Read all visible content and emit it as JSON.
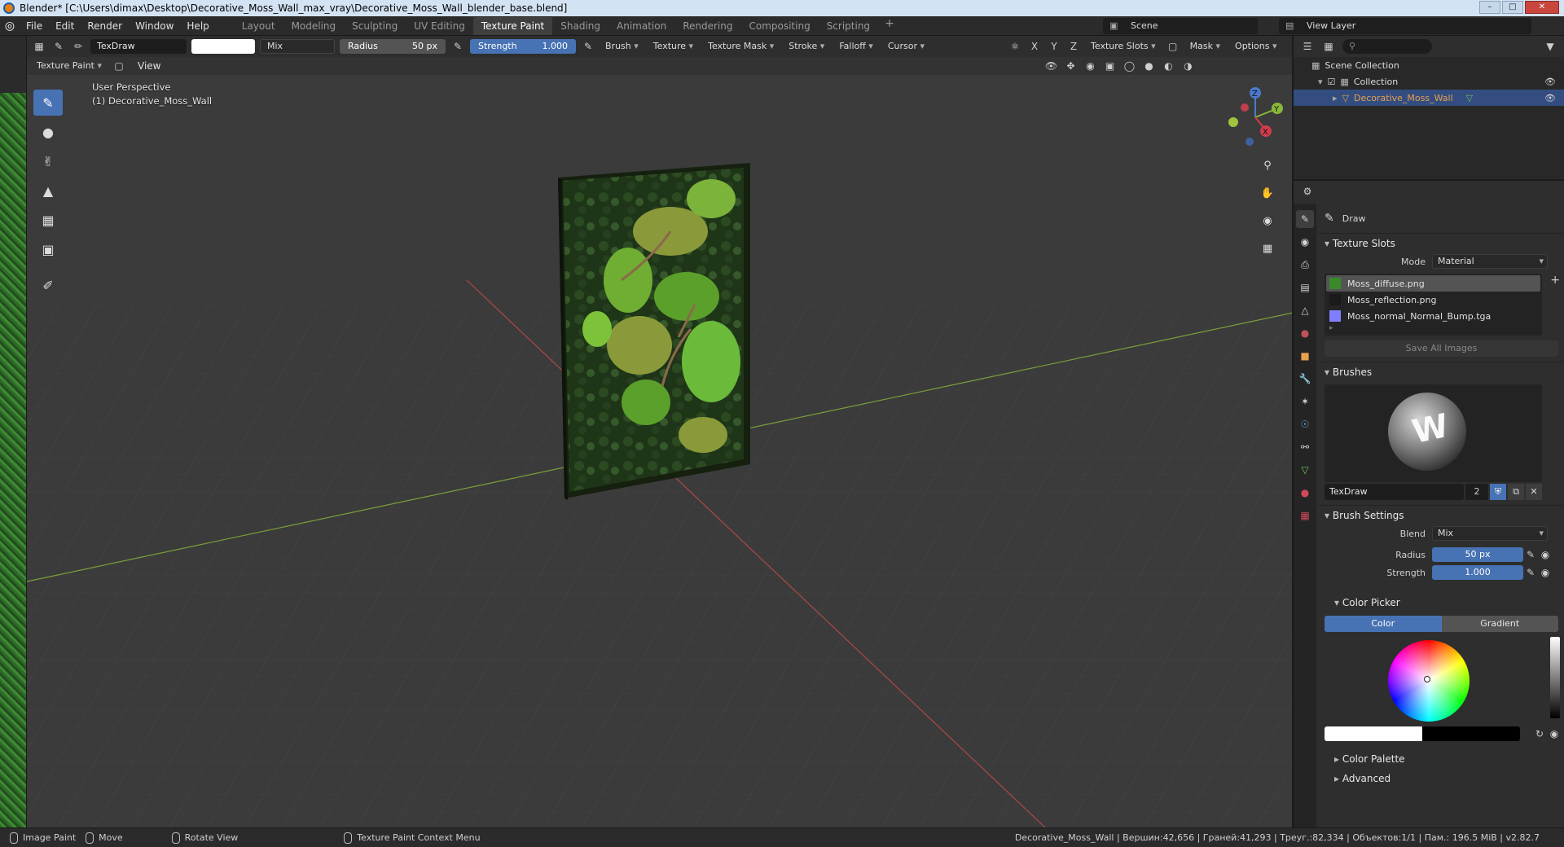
{
  "titlebar": {
    "title": "Blender* [C:\\Users\\dimax\\Desktop\\Decorative_Moss_Wall_max_vray\\Decorative_Moss_Wall_blender_base.blend]",
    "min": "–",
    "max": "□",
    "close": "✕"
  },
  "menu": {
    "items": [
      "File",
      "Edit",
      "Render",
      "Window",
      "Help"
    ]
  },
  "workspaces": {
    "tabs": [
      "Layout",
      "Modeling",
      "Sculpting",
      "UV Editing",
      "Texture Paint",
      "Shading",
      "Animation",
      "Rendering",
      "Compositing",
      "Scripting"
    ],
    "active": "Texture Paint",
    "add": "+"
  },
  "scene": {
    "name": "Scene",
    "view_layer": "View Layer"
  },
  "tool_header": {
    "brush_name": "TexDraw",
    "blend": "Mix",
    "radius_label": "Radius",
    "radius_value": "50 px",
    "strength_label": "Strength",
    "strength_value": "1.000",
    "dropdowns": [
      "Brush",
      "Texture",
      "Texture Mask",
      "Stroke",
      "Falloff",
      "Cursor"
    ],
    "axes": [
      "X",
      "Y",
      "Z"
    ],
    "right_dropdowns": [
      "Texture Slots",
      "Mask",
      "Options"
    ]
  },
  "view_header": {
    "mode": "Texture Paint",
    "view": "View"
  },
  "viewport_info": {
    "line1": "User Perspective",
    "line2": "(1) Decorative_Moss_Wall"
  },
  "gizmo": {
    "z": "Z",
    "y": "Y",
    "x": "X"
  },
  "outliner": {
    "search_placeholder": "",
    "rows": [
      {
        "label": "Scene Collection"
      },
      {
        "label": "Collection"
      },
      {
        "label": "Decorative_Moss_Wall"
      }
    ]
  },
  "properties": {
    "active_tool": "Draw",
    "texture_slots": {
      "title": "Texture Slots",
      "mode_label": "Mode",
      "mode_value": "Material",
      "slots": [
        {
          "name": "Moss_diffuse.png",
          "color": "#3a8a2c"
        },
        {
          "name": "Moss_reflection.png",
          "color": "#1a1a1a"
        },
        {
          "name": "Moss_normal_Normal_Bump.tga",
          "color": "#8080ff"
        }
      ],
      "save_all": "Save All Images"
    },
    "brushes": {
      "title": "Brushes",
      "name": "TexDraw",
      "users": "2"
    },
    "brush_settings": {
      "title": "Brush Settings",
      "blend_label": "Blend",
      "blend_value": "Mix",
      "radius_label": "Radius",
      "radius_value": "50 px",
      "strength_label": "Strength",
      "strength_value": "1.000"
    },
    "color_picker": {
      "title": "Color Picker",
      "tab_color": "Color",
      "tab_gradient": "Gradient"
    },
    "color_palette": "Color Palette",
    "advanced": "Advanced"
  },
  "statusbar": {
    "items": [
      "Image Paint",
      "Move",
      "Rotate View",
      "Texture Paint Context Menu"
    ],
    "stats": "Decorative_Moss_Wall | Вершин:42,656 | Граней:41,293 | Треуг.:82,334 | Объектов:1/1 | Пам.: 196.5 MiB | v2.82.7"
  },
  "colors": {
    "accent": "#4772b3",
    "selection": "#334d80",
    "object_name": "#e8a04e"
  }
}
